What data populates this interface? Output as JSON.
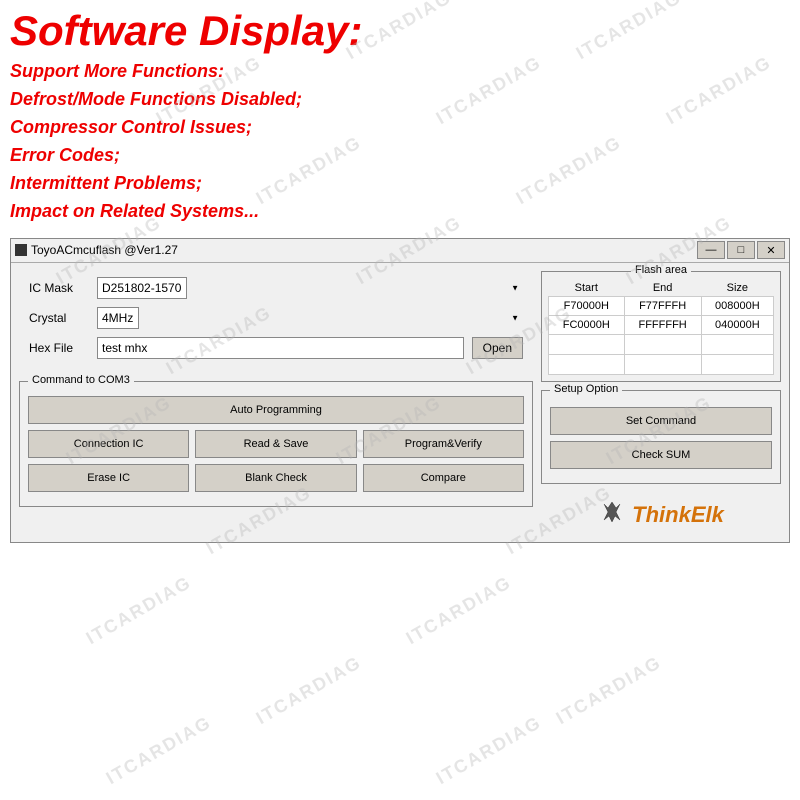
{
  "watermark": "ITCARDIAG",
  "top": {
    "title": "Software Display:",
    "lines": [
      "Support More Functions:",
      "Defrost/Mode Functions Disabled;",
      "Compressor Control Issues;",
      "Error Codes;",
      "Intermittent Problems;",
      "Impact on Related Systems..."
    ]
  },
  "window": {
    "title": "ToyoACmcuflash @Ver1.27",
    "controls": {
      "minimize": "—",
      "restore": "□",
      "close": "✕"
    }
  },
  "form": {
    "ic_mask_label": "IC Mask",
    "ic_mask_value": "D251802-1570",
    "crystal_label": "Crystal",
    "crystal_value": "4MHz",
    "hex_file_label": "Hex File",
    "hex_file_value": "test mhx",
    "open_btn": "Open"
  },
  "command_box": {
    "legend": "Command to  COM3",
    "auto_btn": "Auto Programming",
    "connection_btn": "Connection IC",
    "read_save_btn": "Read & Save",
    "program_verify_btn": "Program&Verify",
    "erase_btn": "Erase IC",
    "blank_check_btn": "Blank Check",
    "compare_btn": "Compare"
  },
  "flash_area": {
    "legend": "Flash area",
    "headers": [
      "Start",
      "End",
      "Size"
    ],
    "rows": [
      [
        "F70000H",
        "F77FFFH",
        "008000H"
      ],
      [
        "FC0000H",
        "FFFFFFH",
        "040000H"
      ],
      [
        "",
        "",
        ""
      ],
      [
        "",
        "",
        ""
      ]
    ]
  },
  "setup_option": {
    "legend": "Setup Option",
    "set_command_btn": "Set Command",
    "check_sum_btn": "Check SUM"
  },
  "logo": {
    "icon": "🦌",
    "text": "ThinkElk"
  }
}
